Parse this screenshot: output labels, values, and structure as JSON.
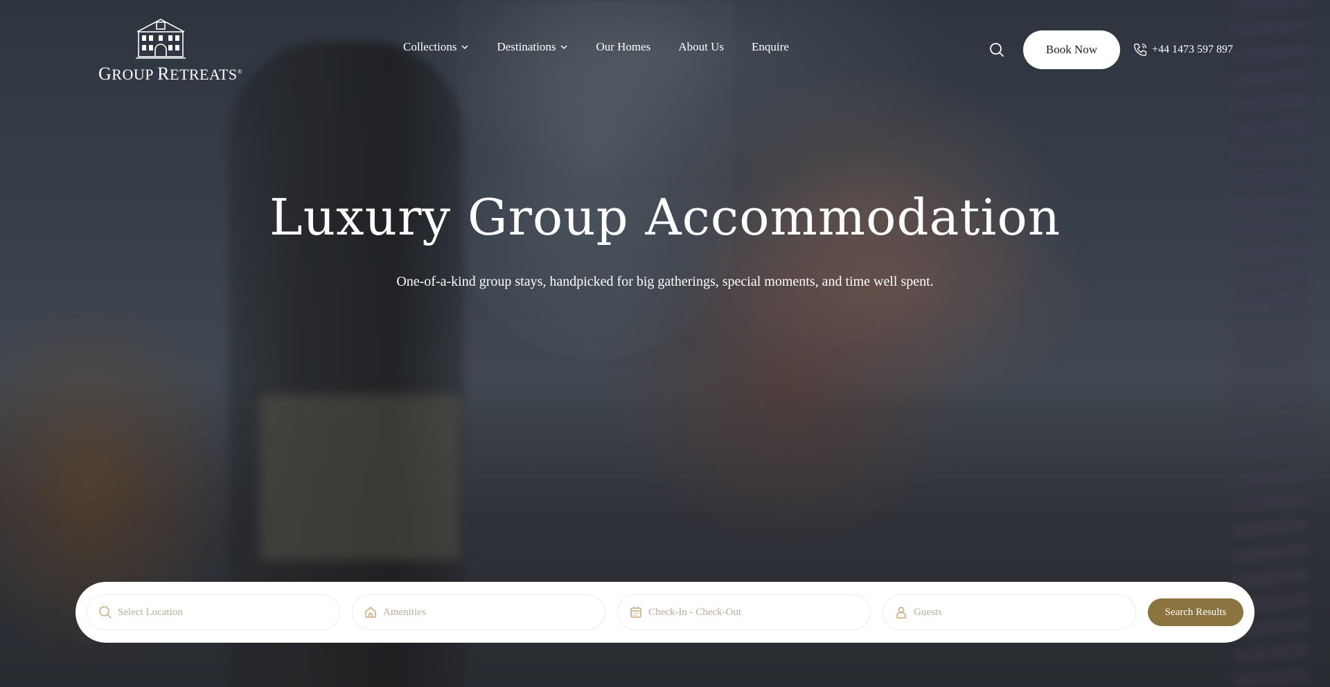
{
  "brand": {
    "logo_name": "Group Retreats",
    "logo_first_cap": "G",
    "logo_first_rest": "ROUP ",
    "logo_second_cap": "R",
    "logo_second_rest": "ETREATS",
    "logo_reg": "®"
  },
  "nav": {
    "items": [
      {
        "label": "Collections",
        "has_dropdown": true
      },
      {
        "label": "Destinations",
        "has_dropdown": true
      },
      {
        "label": "Our Homes",
        "has_dropdown": false
      },
      {
        "label": "About Us",
        "has_dropdown": false
      },
      {
        "label": "Enquire",
        "has_dropdown": false
      }
    ]
  },
  "header": {
    "search_icon": "search-icon",
    "book_label": "Book Now",
    "phone_icon": "phone-icon",
    "phone_number": "+44 1473 597 897"
  },
  "hero": {
    "title": "Luxury Group Accommodation",
    "subtitle": "One-of-a-kind group stays, handpicked for big gatherings, special moments, and time well spent."
  },
  "search": {
    "location_placeholder": "Select Location",
    "amenities_placeholder": "Amenities",
    "dates_placeholder": "Check-In - Check-Out",
    "guests_placeholder": "Guests",
    "submit_label": "Search Results"
  },
  "colors": {
    "accent_gold": "#8b7440",
    "field_text": "#b8ad98",
    "icon_gold": "#c9a776",
    "white": "#ffffff"
  }
}
